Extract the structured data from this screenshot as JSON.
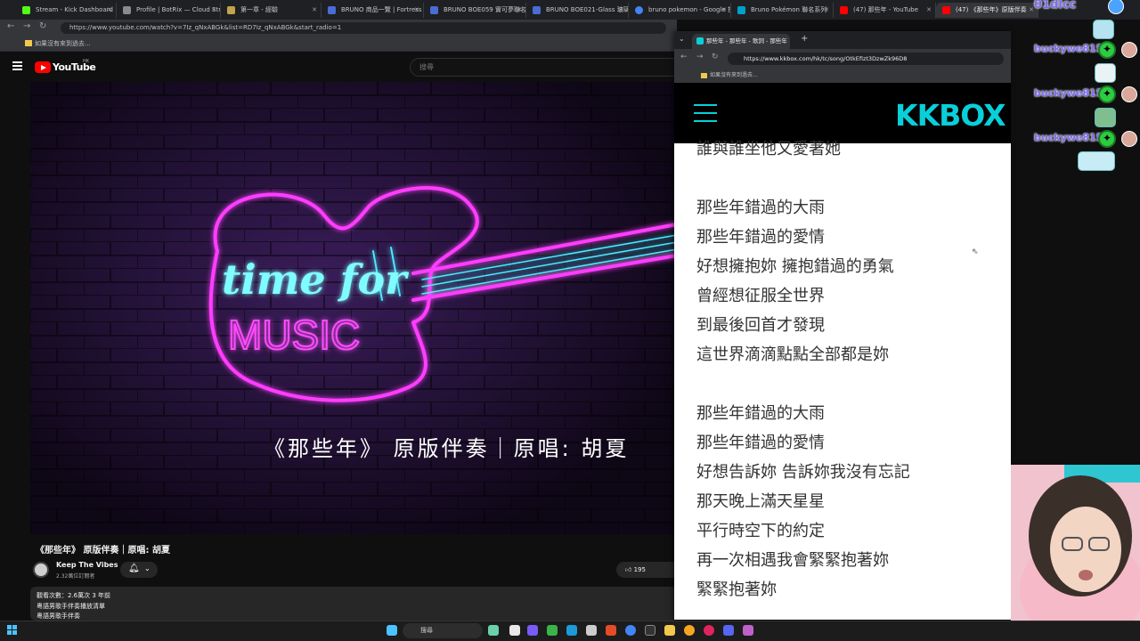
{
  "main_browser": {
    "tabs": [
      {
        "title": "Stream - Kick Dashboard",
        "color": "#53fc18"
      },
      {
        "title": "Profile | BotRix — Cloud Str",
        "color": "#8a8a8a"
      },
      {
        "title": "第一章 - 經驗",
        "color": "#c2a44c"
      },
      {
        "title": "BRUNO 商品一覽 | Fortress",
        "color": "#4a6cd4"
      },
      {
        "title": "BRUNO BOE059 實可夢聯名",
        "color": "#4a6cd4"
      },
      {
        "title": "BRUNO BOE021-Glass 玻璃",
        "color": "#4a6cd4"
      },
      {
        "title": "bruno pokemon - Google 搜尋",
        "color": "#4285f4"
      },
      {
        "title": "Bruno Pokémon 聯名系列",
        "color": "#00a1c9"
      },
      {
        "title": "(47) 那些年 - YouTube",
        "color": "#ff0000"
      },
      {
        "title": "(47) 《那些年》原版伴奏",
        "color": "#ff0000"
      }
    ],
    "url": "https://www.youtube.com/watch?v=7Iz_qNxABGk&list=RD7Iz_qNxABGk&start_radio=1",
    "bookmark": "如果沒有來到過去..."
  },
  "youtube": {
    "brand": "YouTube",
    "region": "HK",
    "search_placeholder": "搜尋",
    "video_caption": "《那些年》 原版伴奏｜原唱: 胡夏",
    "video_art_line1": "time for",
    "video_art_line2": "MUSIC",
    "title": "《那些年》 原版伴奏｜原唱: 胡夏",
    "channel": "Keep The Vibes",
    "subscribers": "2.32萬位訂閱者",
    "likes": "195",
    "desc_views": "觀看次數：2.6萬次  3 年前",
    "desc_line2": "粵語男歌手伴奏播放清單",
    "desc_line3": "粵語男歌手伴奏"
  },
  "kkbox_window": {
    "tab_title": "那些年 - 那些年 - 歌詞 - 那些年",
    "url": "https://www.kkbox.com/hk/tc/song/OtkEfizt3DzwZk96D8",
    "bookmark": "如果沒有來到過去...",
    "logo": "KKBOX",
    "lyrics": [
      "誰與誰坐他又愛著她",
      "那些年錯過的大雨",
      "那些年錯過的愛情",
      "好想擁抱妳 擁抱錯過的勇氣",
      "曾經想征服全世界",
      "到最後回首才發現",
      "這世界滴滴點點全部都是妳",
      "那些年錯過的大雨",
      "那些年錯過的愛情",
      "好想告訴妳 告訴妳我沒有忘記",
      "那天晚上滿天星星",
      "平行時空下的約定",
      "再一次相遇我會緊緊抱著妳",
      "緊緊抱著妳"
    ]
  },
  "stream_chat": {
    "top_user": "01dlcc",
    "messages": [
      "buckywe815",
      "buckywe815",
      "buckywe815"
    ]
  },
  "taskbar": {
    "search_placeholder": "搜尋"
  }
}
